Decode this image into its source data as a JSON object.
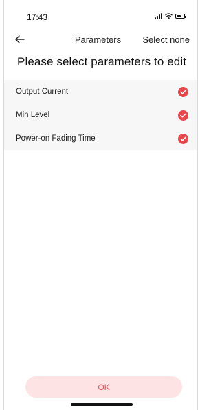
{
  "status_bar": {
    "time": "17:43",
    "icons": [
      "signal-icon",
      "wifi-icon",
      "battery-icon"
    ]
  },
  "nav": {
    "title": "Parameters",
    "select_none_label": "Select none",
    "back_icon": "back-arrow-icon"
  },
  "heading": "Please select parameters to edit",
  "parameters": [
    {
      "label": "Output Current",
      "selected": true
    },
    {
      "label": "Min Level",
      "selected": true
    },
    {
      "label": "Power-on Fading Time",
      "selected": true
    }
  ],
  "ok_button": {
    "label": "OK"
  },
  "colors": {
    "accent": "#e8464b",
    "button_bg": "#fde3e3",
    "button_text": "#e55a5a",
    "list_bg": "#f7f7f7"
  }
}
